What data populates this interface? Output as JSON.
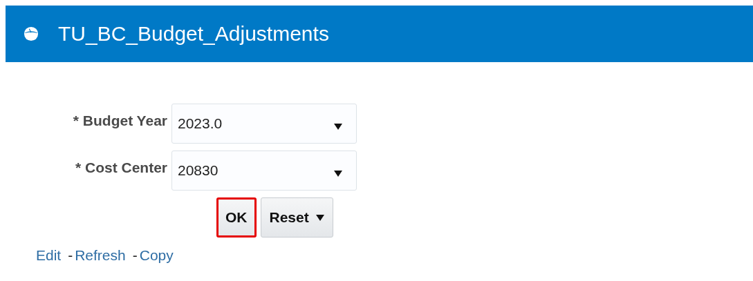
{
  "header": {
    "title": "TU_BC_Budget_Adjustments"
  },
  "fields": [
    {
      "label": "* Budget Year",
      "value": "2023.0"
    },
    {
      "label": "* Cost Center",
      "value": "20830"
    }
  ],
  "buttons": [
    {
      "label": "OK",
      "kind": "plain",
      "highlighted": true
    },
    {
      "label": "Reset",
      "kind": "menu",
      "highlighted": false
    }
  ],
  "links": [
    {
      "label": "Edit"
    },
    {
      "separator": "-",
      "label": "Refresh"
    },
    {
      "separator": "-",
      "label": "Copy"
    }
  ]
}
